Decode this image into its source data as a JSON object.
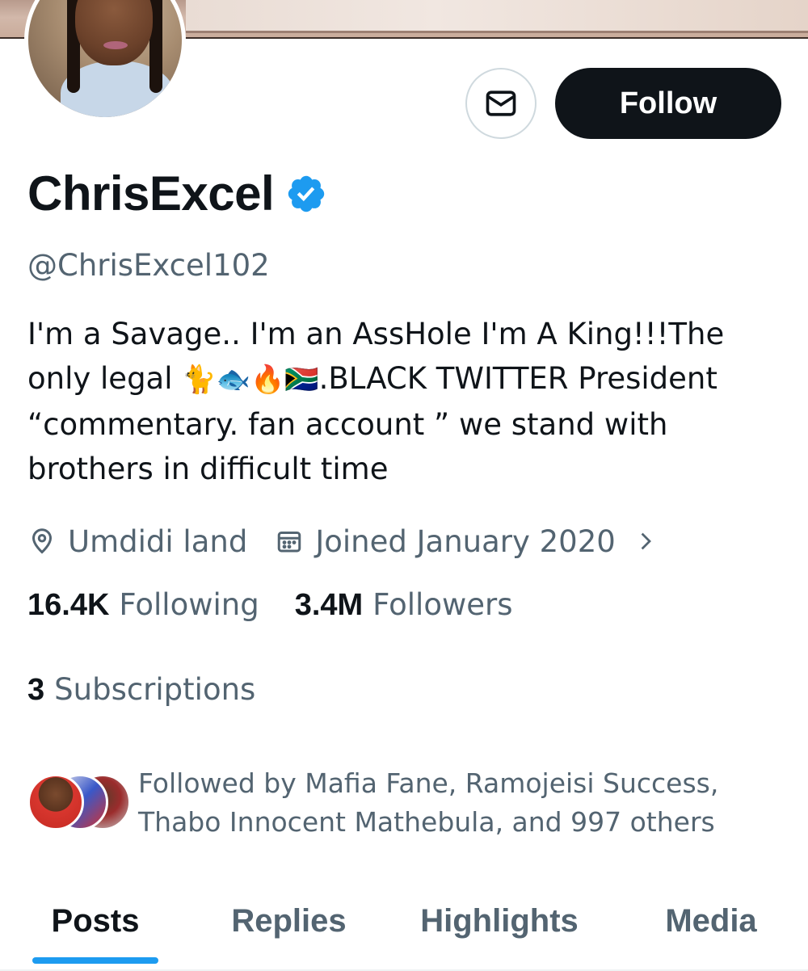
{
  "profile": {
    "name": "ChrisExcel",
    "handle": "@ChrisExcel102",
    "verified": true,
    "bio_lines": [
      "I'm a Savage.. I'm an AssHole I'm A King!!!The",
      "only legal",
      ".BLACK TWITTER President",
      "“commentary. fan account ” we stand with",
      "brothers in difficult time"
    ],
    "bio_emojis": [
      "🐈",
      "🐟",
      "🔥",
      "🇿🇦"
    ],
    "location": "Umdidi land",
    "joined": "Joined January 2020",
    "following_count": "16.4K",
    "following_label": "Following",
    "followers_count": "3.4M",
    "followers_label": "Followers",
    "subscriptions_count": "3",
    "subscriptions_label": "Subscriptions",
    "followed_by_line1": "Followed by Mafia Fane, Ramojeisi Success,",
    "followed_by_line2": "Thabo Innocent Mathebula, and 997 others"
  },
  "actions": {
    "message_icon": "envelope-icon",
    "follow_label": "Follow"
  },
  "tabs": [
    {
      "label": "Posts",
      "active": true
    },
    {
      "label": "Replies",
      "active": false
    },
    {
      "label": "Highlights",
      "active": false
    },
    {
      "label": "Media",
      "active": false
    }
  ],
  "icons": {
    "location": "location-pin-icon",
    "calendar": "calendar-icon",
    "chevron": "chevron-right-icon",
    "verified": "verified-badge-icon"
  },
  "colors": {
    "text_primary": "#0f1419",
    "text_secondary": "#536471",
    "accent": "#1d9bf0",
    "follow_bg": "#0f1419",
    "border": "#cfd9de"
  }
}
